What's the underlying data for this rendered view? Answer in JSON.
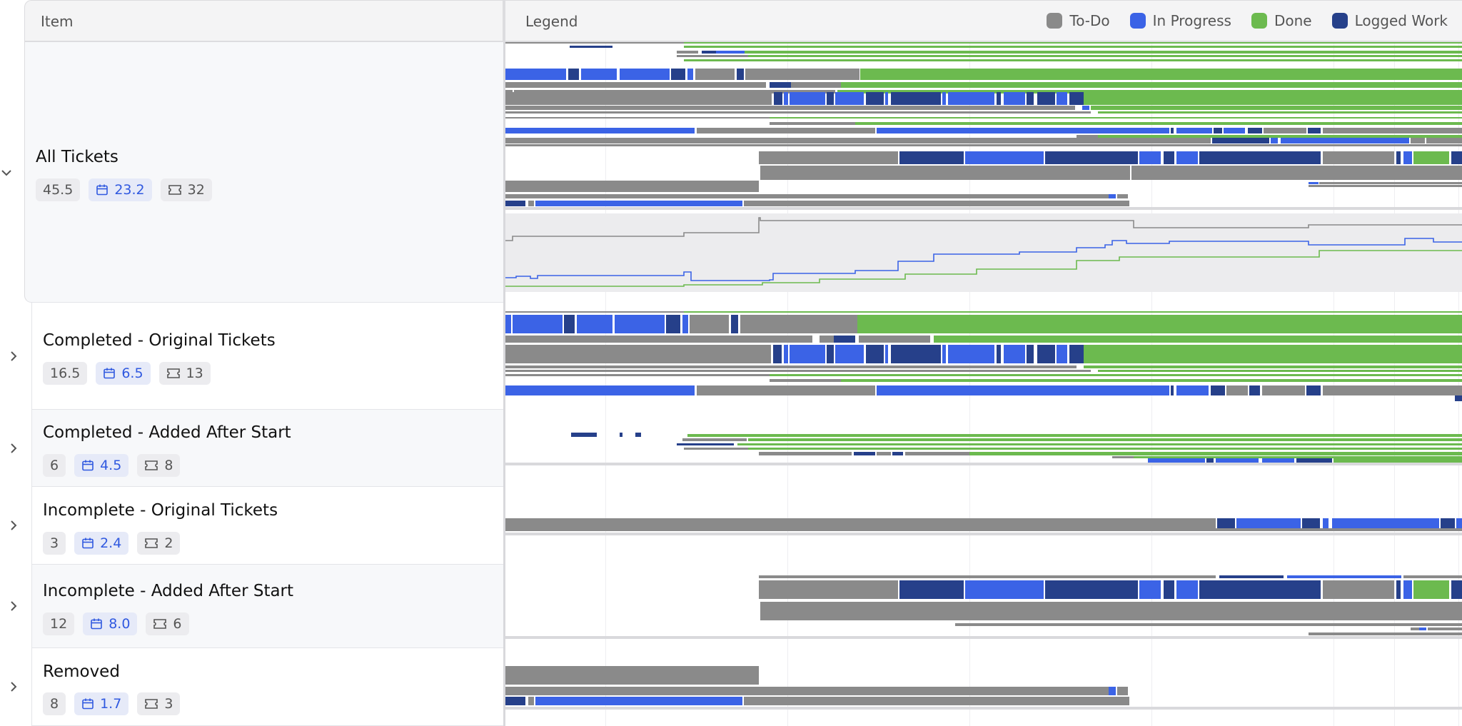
{
  "header": {
    "item_label": "Item",
    "legend_label": "Legend"
  },
  "legend": [
    {
      "name": "swatch-todo",
      "label": "To-Do",
      "color": "#8a8a8a"
    },
    {
      "name": "swatch-in-progress",
      "label": "In Progress",
      "color": "#3b63e6"
    },
    {
      "name": "swatch-done",
      "label": "Done",
      "color": "#6cba4f"
    },
    {
      "name": "swatch-logged-work",
      "label": "Logged Work",
      "color": "#26408a"
    }
  ],
  "colors": {
    "todo": "#8a8a8a",
    "in_progress": "#3b63e6",
    "done": "#6cba4f",
    "logged": "#26408a"
  },
  "rows": [
    {
      "title": "All Tickets",
      "points": "45.5",
      "days": "23.2",
      "tickets": "32",
      "expanded": true
    },
    {
      "title": "Completed - Original Tickets",
      "points": "16.5",
      "days": "6.5",
      "tickets": "13",
      "expanded": false
    },
    {
      "title": "Completed - Added After Start",
      "points": "6",
      "days": "4.5",
      "tickets": "8",
      "expanded": false
    },
    {
      "title": "Incomplete - Original Tickets",
      "points": "3",
      "days": "2.4",
      "tickets": "2",
      "expanded": false
    },
    {
      "title": "Incomplete - Added After Start",
      "points": "12",
      "days": "8.0",
      "tickets": "6",
      "expanded": false
    },
    {
      "title": "Removed",
      "points": "8",
      "days": "1.7",
      "tickets": "3",
      "expanded": false
    }
  ]
}
